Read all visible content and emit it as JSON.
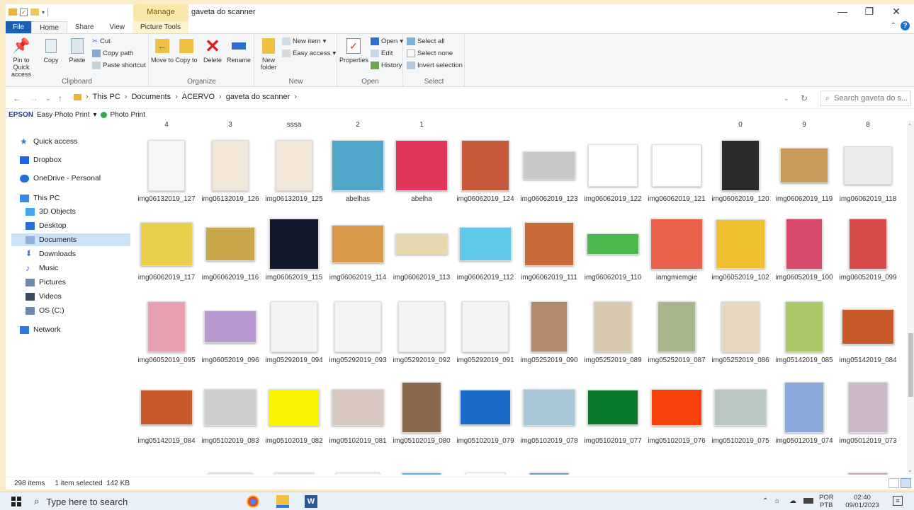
{
  "window": {
    "context_tab": "Manage",
    "title": "gaveta do scanner",
    "minimize": "—",
    "restore": "❐",
    "close": "✕"
  },
  "tabs": [
    "File",
    "Home",
    "Share",
    "View",
    "Picture Tools"
  ],
  "ribbon": {
    "clipboard": {
      "name": "Clipboard",
      "pin": "Pin to Quick access",
      "copy": "Copy",
      "paste": "Paste",
      "cut": "Cut",
      "copy_path": "Copy path",
      "paste_shortcut": "Paste shortcut"
    },
    "organize": {
      "name": "Organize",
      "move_to": "Move to",
      "copy_to": "Copy to",
      "delete": "Delete",
      "rename": "Rename"
    },
    "new": {
      "name": "New",
      "new_folder": "New folder",
      "new_item": "New item",
      "easy_access": "Easy access"
    },
    "open": {
      "name": "Open",
      "properties": "Properties",
      "open": "Open",
      "edit": "Edit",
      "history": "History"
    },
    "select": {
      "name": "Select",
      "select_all": "Select all",
      "select_none": "Select none",
      "invert": "Invert selection"
    }
  },
  "address": {
    "crumbs": [
      "This PC",
      "Documents",
      "ACERVO",
      "gaveta do scanner"
    ],
    "search_placeholder": "Search gaveta do s..."
  },
  "epson": {
    "brand": "EPSON",
    "app": "Easy Photo Print",
    "photo_print": "Photo Print"
  },
  "nav": [
    {
      "label": "Quick access",
      "icon": "star-icon",
      "color": "#2f7fd8"
    },
    {
      "label": "Dropbox",
      "icon": "dropbox-icon",
      "color": "#1f63e6"
    },
    {
      "label": "OneDrive - Personal",
      "icon": "cloud-icon",
      "color": "#1a73d9"
    },
    {
      "label": "This PC",
      "icon": "computer-icon",
      "color": "#3b8be0"
    },
    {
      "label": "3D Objects",
      "icon": "cube-icon",
      "color": "#3fa6f0"
    },
    {
      "label": "Desktop",
      "icon": "desktop-icon",
      "color": "#2d6fd0"
    },
    {
      "label": "Documents",
      "icon": "document-icon",
      "color": "#8fb0d8"
    },
    {
      "label": "Downloads",
      "icon": "download-icon",
      "color": "#2d7ae0"
    },
    {
      "label": "Music",
      "icon": "music-icon",
      "color": "#2d6fd0"
    },
    {
      "label": "Pictures",
      "icon": "pictures-icon",
      "color": "#6f8aa8"
    },
    {
      "label": "Videos",
      "icon": "video-icon",
      "color": "#3c4b60"
    },
    {
      "label": "OS (C:)",
      "icon": "drive-icon",
      "color": "#6f8aa8"
    },
    {
      "label": "Network",
      "icon": "network-icon",
      "color": "#2d7ae0"
    }
  ],
  "top_labels": [
    "4",
    "3",
    "sssa",
    "2",
    "1",
    "",
    "",
    "",
    "",
    "0",
    "9",
    "8"
  ],
  "rows": [
    [
      {
        "name": "img06132019_127",
        "color": "#f6f6f6",
        "w": 52,
        "h": 72
      },
      {
        "name": "img06132019_126",
        "color": "#f2e6d8",
        "w": 52,
        "h": 72
      },
      {
        "name": "img06132019_125",
        "color": "#f2e6d8",
        "w": 52,
        "h": 72
      },
      {
        "name": "abelhas",
        "color": "#4fa6c8",
        "w": 74,
        "h": 72
      },
      {
        "name": "abelha",
        "color": "#e2365a",
        "w": 74,
        "h": 72
      },
      {
        "name": "img06062019_124",
        "color": "#c85a3c",
        "w": 68,
        "h": 72
      },
      {
        "name": "img06062019_123",
        "color": "#c8c8c8",
        "w": 74,
        "h": 40
      },
      {
        "name": "img06062019_122",
        "color": "#ffffff",
        "w": 70,
        "h": 60
      },
      {
        "name": "img06062019_121",
        "color": "#ffffff",
        "w": 70,
        "h": 60
      },
      {
        "name": "img06062019_120",
        "color": "#2b2b2b",
        "w": 54,
        "h": 72
      },
      {
        "name": "img06062019_119",
        "color": "#c89a5a",
        "w": 68,
        "h": 50
      },
      {
        "name": "img06062019_118",
        "color": "#eaeaea",
        "w": 68,
        "h": 54
      }
    ],
    [
      {
        "name": "img06062019_117",
        "color": "#e8d04a",
        "w": 74,
        "h": 62
      },
      {
        "name": "img06062019_116",
        "color": "#c8a84a",
        "w": 70,
        "h": 48
      },
      {
        "name": "img06062019_115",
        "color": "#10182a",
        "w": 70,
        "h": 72
      },
      {
        "name": "img06062019_114",
        "color": "#d89a4a",
        "w": 74,
        "h": 54
      },
      {
        "name": "img06062019_113",
        "color": "#e8d8b0",
        "w": 74,
        "h": 30
      },
      {
        "name": "img06062019_112",
        "color": "#5ec8e8",
        "w": 74,
        "h": 48
      },
      {
        "name": "img06062019_111",
        "color": "#c86a3a",
        "w": 70,
        "h": 62
      },
      {
        "name": "img06062019_110",
        "color": "#4ab84a",
        "w": 74,
        "h": 30
      },
      {
        "name": "iamgmiemgie",
        "color": "#e8604a",
        "w": 74,
        "h": 72
      },
      {
        "name": "img06052019_102",
        "color": "#f0c030",
        "w": 70,
        "h": 70
      },
      {
        "name": "img06052019_100",
        "color": "#d84a6a",
        "w": 52,
        "h": 72
      },
      {
        "name": "img06052019_099",
        "color": "#d84a4a",
        "w": 54,
        "h": 72
      }
    ],
    [
      {
        "name": "img06052019_095",
        "color": "#e8a0b0",
        "w": 54,
        "h": 72
      },
      {
        "name": "img06052019_096",
        "color": "#b89ad0",
        "w": 74,
        "h": 46
      },
      {
        "name": "img05292019_094",
        "color": "#f4f4f4",
        "w": 66,
        "h": 72
      },
      {
        "name": "img05292019_093",
        "color": "#f4f4f4",
        "w": 66,
        "h": 72
      },
      {
        "name": "img05292019_092",
        "color": "#f4f4f4",
        "w": 66,
        "h": 72
      },
      {
        "name": "img05292019_091",
        "color": "#f4f4f4",
        "w": 66,
        "h": 72
      },
      {
        "name": "img05252019_090",
        "color": "#b08a6a",
        "w": 52,
        "h": 72
      },
      {
        "name": "img05252019_089",
        "color": "#d8c8b0",
        "w": 54,
        "h": 72
      },
      {
        "name": "img05252019_087",
        "color": "#a8b88a",
        "w": 54,
        "h": 72
      },
      {
        "name": "img05252019_086",
        "color": "#e8d8c0",
        "w": 54,
        "h": 72
      },
      {
        "name": "img05142019_085",
        "color": "#a8c86a",
        "w": 54,
        "h": 72
      },
      {
        "name": "img05142019_084",
        "color": "#c85a2a",
        "w": 74,
        "h": 50
      }
    ],
    [
      {
        "name": "img05142019_084",
        "color": "#c85a2a",
        "w": 74,
        "h": 50
      },
      {
        "name": "img05102019_083",
        "color": "#cfcfcf",
        "w": 74,
        "h": 52
      },
      {
        "name": "img05102019_082",
        "color": "#f8f400",
        "w": 72,
        "h": 52
      },
      {
        "name": "img05102019_081",
        "color": "#d8c8c0",
        "w": 74,
        "h": 52
      },
      {
        "name": "img05102019_080",
        "color": "#8a6a4a",
        "w": 56,
        "h": 72
      },
      {
        "name": "img05102019_079",
        "color": "#1a6ac8",
        "w": 72,
        "h": 50
      },
      {
        "name": "img05102019_078",
        "color": "#a8c8d8",
        "w": 74,
        "h": 52
      },
      {
        "name": "img05102019_077",
        "color": "#0a7a2a",
        "w": 72,
        "h": 50
      },
      {
        "name": "img05102019_076",
        "color": "#f8400a",
        "w": 72,
        "h": 52
      },
      {
        "name": "img05102019_075",
        "color": "#b8c8c0",
        "w": 74,
        "h": 52
      },
      {
        "name": "img05012019_074",
        "color": "#8aa8d8",
        "w": 56,
        "h": 72
      },
      {
        "name": "img05012019_073",
        "color": "#c8b8c8",
        "w": 56,
        "h": 72
      }
    ],
    [
      {
        "name": "",
        "color": "#a85a4a",
        "w": 74,
        "h": 16
      },
      {
        "name": "",
        "color": "#e8e8f0",
        "w": 62,
        "h": 40
      },
      {
        "name": "",
        "color": "#f0e8e8",
        "w": 56,
        "h": 40
      },
      {
        "name": "",
        "color": "#f4f4f4",
        "w": 62,
        "h": 40
      },
      {
        "name": "",
        "color": "#5ab8e8",
        "w": 56,
        "h": 40
      },
      {
        "name": "",
        "color": "#ffffff",
        "w": 56,
        "h": 40
      },
      {
        "name": "",
        "color": "#6a9ac8",
        "w": 56,
        "h": 40
      },
      {
        "name": "",
        "color": "#c8a8b8",
        "w": 74,
        "h": 16
      },
      {
        "name": "",
        "color": "#1a8ac8",
        "w": 74,
        "h": 16
      },
      {
        "name": "",
        "color": "#8a2a3a",
        "w": 74,
        "h": 16
      },
      {
        "name": "",
        "color": "#c8a8c8",
        "w": 74,
        "h": 16
      },
      {
        "name": "",
        "color": "#c8a8a8",
        "w": 56,
        "h": 40
      }
    ]
  ],
  "status": {
    "items": "298 items",
    "selected": "1 item selected",
    "size": "142 KB"
  },
  "taskbar": {
    "search": "Type here to search",
    "lang": "POR",
    "layout": "PTB",
    "time": "02:40",
    "date": "09/01/2023"
  }
}
